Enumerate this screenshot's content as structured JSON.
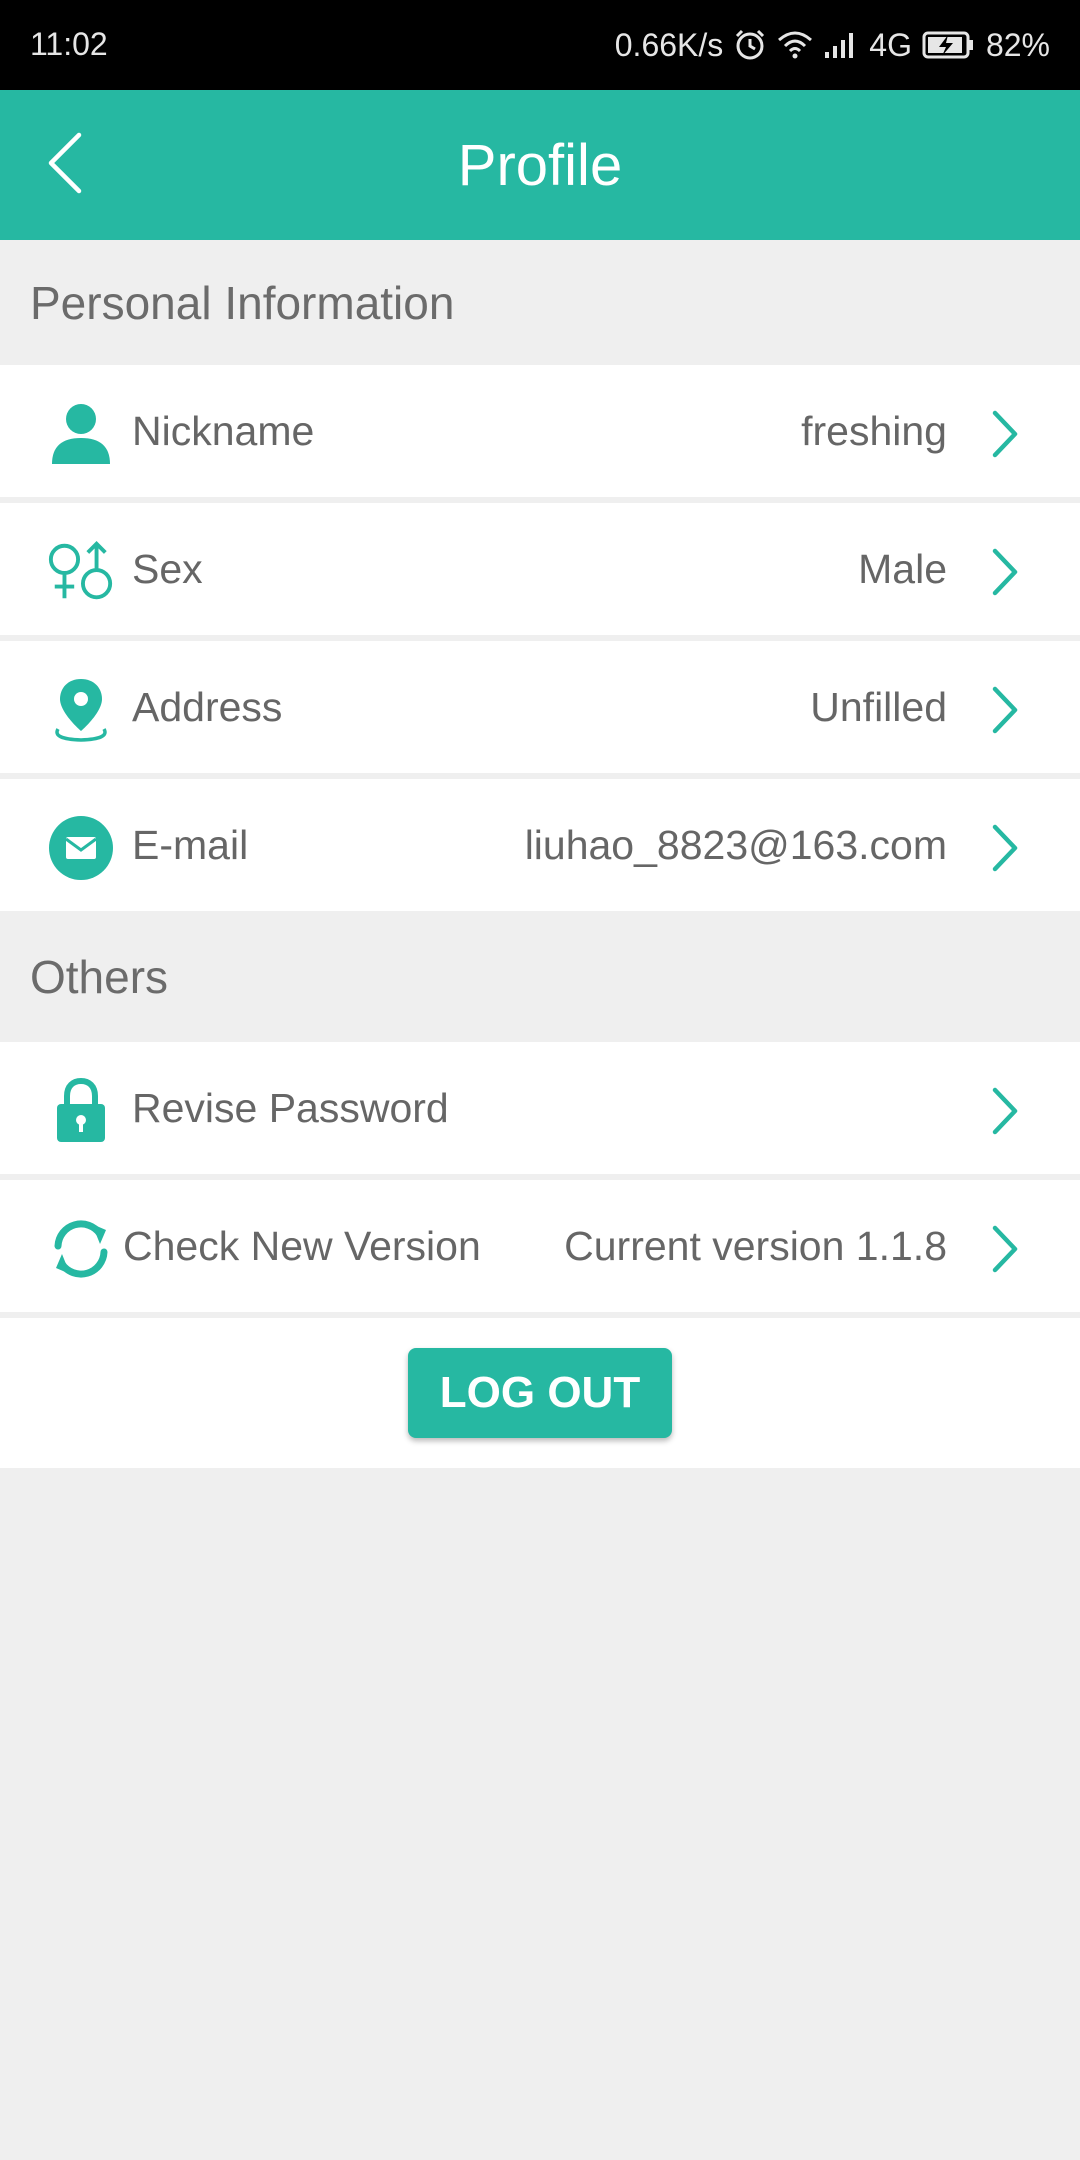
{
  "status_bar": {
    "time": "11:02",
    "network_speed": "0.66K/s",
    "network_type": "4G",
    "battery": "82%",
    "icons": [
      "alarm-icon",
      "wifi-icon",
      "signal-icon",
      "battery-charging-icon"
    ]
  },
  "header": {
    "title": "Profile",
    "back_icon": "chevron-left-icon"
  },
  "sections": {
    "personal": {
      "title": "Personal Information",
      "rows": [
        {
          "label": "Nickname",
          "value": "freshing",
          "icon": "person-icon"
        },
        {
          "label": "Sex",
          "value": "Male",
          "icon": "gender-icon"
        },
        {
          "label": "Address",
          "value": "Unfilled",
          "icon": "location-pin-icon"
        },
        {
          "label": "E-mail",
          "value": "liuhao_8823@163.com",
          "icon": "mail-icon"
        }
      ]
    },
    "others": {
      "title": "Others",
      "rows": [
        {
          "label": "Revise Password",
          "value": "",
          "icon": "lock-icon"
        },
        {
          "label": "Check New Version",
          "value": "Current version 1.1.8",
          "icon": "refresh-icon"
        }
      ]
    }
  },
  "logout": {
    "label": "LOG OUT"
  },
  "colors": {
    "accent": "#26b8a2",
    "background": "#efefef",
    "text": "#666666"
  }
}
